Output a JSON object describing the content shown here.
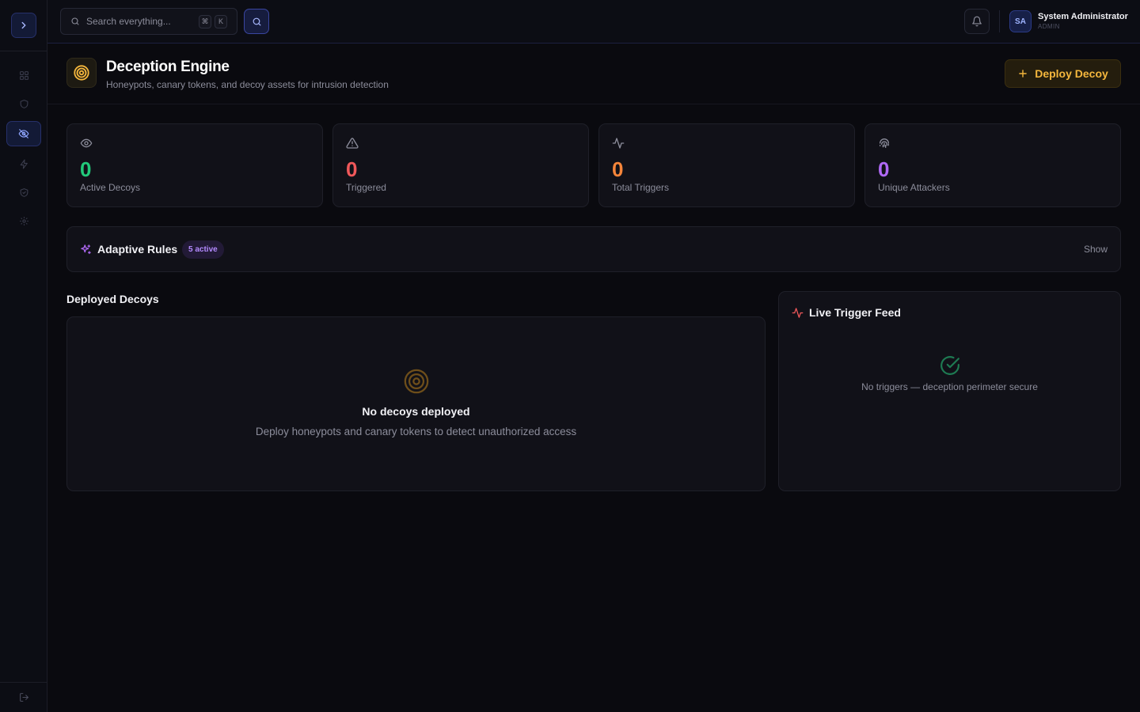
{
  "sidebar": {
    "toggle_icon": "chevron-right-icon",
    "items": [
      {
        "name": "grid-icon",
        "active": false
      },
      {
        "name": "shield-icon",
        "active": false
      },
      {
        "name": "eye-off-icon",
        "active": true
      },
      {
        "name": "bolt-icon",
        "active": false
      },
      {
        "name": "shield-check-icon",
        "active": false
      },
      {
        "name": "gear-icon",
        "active": false
      }
    ],
    "logout_icon": "logout-icon"
  },
  "topbar": {
    "search_placeholder": "Search everything...",
    "shortcut_keys": [
      "⌘",
      "K"
    ],
    "user": {
      "initials": "SA",
      "name": "System Administrator",
      "role": "ADMIN"
    }
  },
  "page_header": {
    "title": "Deception Engine",
    "subtitle": "Honeypots, canary tokens, and decoy assets for intrusion detection",
    "deploy_button_label": "Deploy Decoy"
  },
  "stats": [
    {
      "value": "0",
      "label": "Active Decoys",
      "icon": "eye-icon",
      "color": "#22c97a"
    },
    {
      "value": "0",
      "label": "Triggered",
      "icon": "alert-triangle-icon",
      "color": "#f0585a"
    },
    {
      "value": "0",
      "label": "Total Triggers",
      "icon": "activity-icon",
      "color": "#f5853a"
    },
    {
      "value": "0",
      "label": "Unique Attackers",
      "icon": "fingerprint-icon",
      "color": "#b069f5"
    }
  ],
  "adaptive_rules": {
    "title": "Adaptive Rules",
    "badge": "5 active",
    "toggle_label": "Show"
  },
  "deployed_decoys": {
    "title": "Deployed Decoys",
    "empty_title": "No decoys deployed",
    "empty_subtitle": "Deploy honeypots and canary tokens to detect unauthorized access"
  },
  "trigger_feed": {
    "title": "Live Trigger Feed",
    "empty_text": "No triggers — deception perimeter secure"
  },
  "colors": {
    "accent": "#f5b73d",
    "brand": "#3a46a0",
    "success": "#22c97a",
    "danger": "#f0585a"
  }
}
